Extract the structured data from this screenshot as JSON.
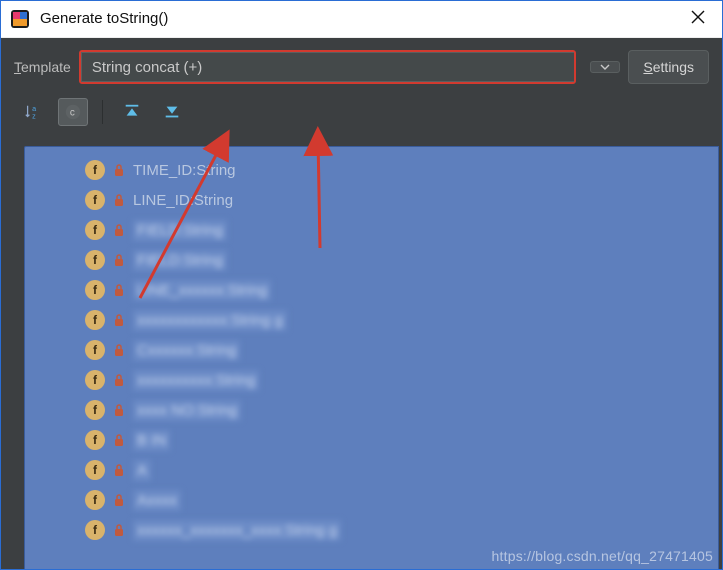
{
  "window": {
    "title": "Generate toString()",
    "template_label_pre": "T",
    "template_label_post": "emplate",
    "template_value": "String concat (+)",
    "settings_pre": "S",
    "settings_post": "ettings"
  },
  "toolbar": {
    "sort_name": "sort-alpha-icon",
    "class_name": "class-filter-icon",
    "expand_name": "expand-all-icon",
    "collapse_name": "collapse-all-icon"
  },
  "fields": [
    {
      "label": "TIME_ID:String",
      "blur": false
    },
    {
      "label": "LINE_ID:String",
      "blur": false
    },
    {
      "label": "FIELD:String",
      "blur": true
    },
    {
      "label": "FIELD:String",
      "blur": true
    },
    {
      "label": "LINE_xxxxxx:String",
      "blur": true
    },
    {
      "label": "xxxxxxxxxxxx:String g",
      "blur": true
    },
    {
      "label": "Cxxxxxx:String",
      "blur": true
    },
    {
      "label": "xxxxxxxxxx:String",
      "blur": true
    },
    {
      "label": "xxxx NO:String",
      "blur": true
    },
    {
      "label": "B   IN",
      "blur": true
    },
    {
      "label": "A",
      "blur": true
    },
    {
      "label": "Axxxx",
      "blur": true
    },
    {
      "label": "xxxxxx_xxxxxxx_xxxx:String g",
      "blur": true
    }
  ],
  "watermark": "https://blog.csdn.net/qq_27471405",
  "colors": {
    "highlight_border": "#d23a2f",
    "panel_bg": "#3c3f41",
    "list_bg": "#5e7fbd",
    "badge": "#d9b36b"
  }
}
